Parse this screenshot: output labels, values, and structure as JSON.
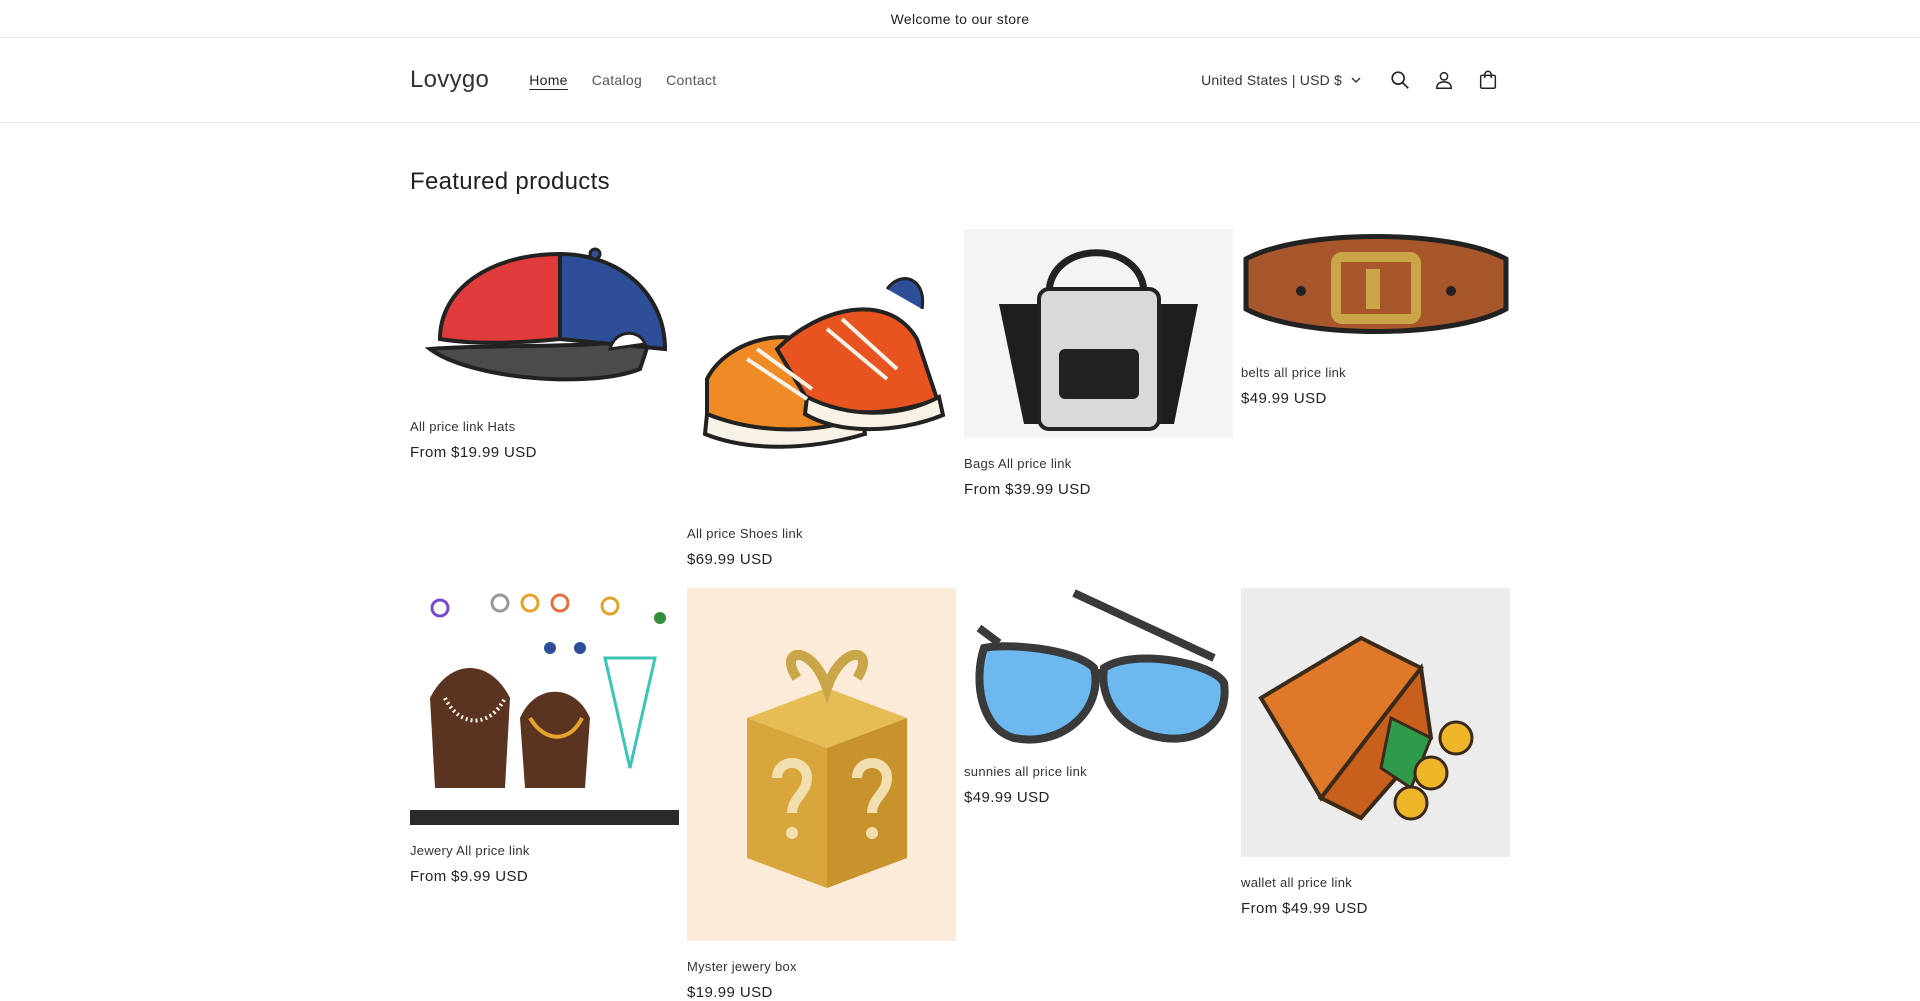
{
  "announcement": "Welcome to our store",
  "header": {
    "logo": "Lovygo",
    "nav": [
      "Home",
      "Catalog",
      "Contact"
    ],
    "locale": "United States | USD $"
  },
  "section_title": "Featured products",
  "products": [
    {
      "title": "All price link Hats",
      "price": "From $19.99 USD"
    },
    {
      "title": "All price Shoes link",
      "price": "$69.99 USD"
    },
    {
      "title": "Bags All price link",
      "price": "From $39.99 USD"
    },
    {
      "title": "belts all price link",
      "price": "$49.99 USD"
    },
    {
      "title": "Jewery All price link",
      "price": "From $9.99 USD"
    },
    {
      "title": "Myster jewery box",
      "price": "$19.99 USD"
    },
    {
      "title": "sunnies all price link",
      "price": "$49.99 USD"
    },
    {
      "title": "wallet all price link",
      "price": "From $49.99 USD"
    }
  ],
  "icons": [
    "search-icon",
    "account-icon",
    "cart-icon",
    "chevron-down-icon"
  ]
}
